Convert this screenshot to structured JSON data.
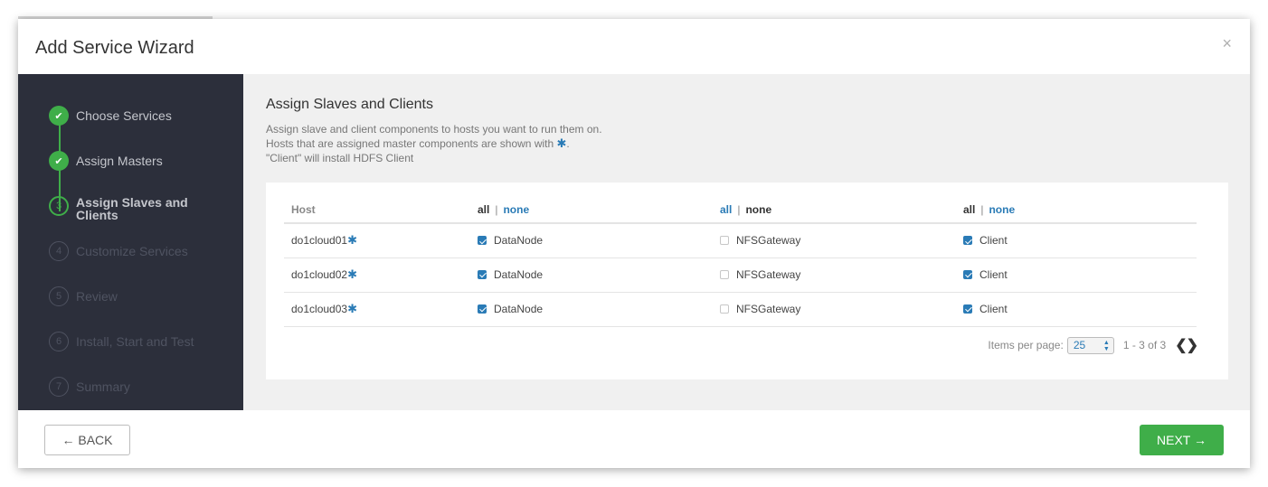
{
  "wizard": {
    "title": "Add Service Wizard",
    "close_glyph": "×",
    "steps": [
      {
        "label": "Choose Services",
        "status": "done",
        "marker": "✔"
      },
      {
        "label": "Assign Masters",
        "status": "done",
        "marker": "✔"
      },
      {
        "label": "Assign Slaves and Clients",
        "status": "active",
        "marker": "3"
      },
      {
        "label": "Customize Services",
        "status": "todo",
        "marker": "4"
      },
      {
        "label": "Review",
        "status": "todo",
        "marker": "5"
      },
      {
        "label": "Install, Start and Test",
        "status": "todo",
        "marker": "6"
      },
      {
        "label": "Summary",
        "status": "todo",
        "marker": "7"
      }
    ]
  },
  "content": {
    "title": "Assign Slaves and Clients",
    "desc_line1": "Assign slave and client components to hosts you want to run them on.",
    "desc_line2": "Hosts that are assigned master components are shown with",
    "desc_line2_end": ".",
    "desc_line3": "\"Client\" will install HDFS Client",
    "master_marker": "✱"
  },
  "table": {
    "host_header": "Host",
    "all_label": "all",
    "none_label": "none",
    "separator": "|",
    "rows": [
      {
        "host": "do1cloud01",
        "datanode": {
          "label": "DataNode",
          "checked": true
        },
        "nfs": {
          "label": "NFSGateway",
          "checked": false
        },
        "client": {
          "label": "Client",
          "checked": true
        }
      },
      {
        "host": "do1cloud02",
        "datanode": {
          "label": "DataNode",
          "checked": true
        },
        "nfs": {
          "label": "NFSGateway",
          "checked": false
        },
        "client": {
          "label": "Client",
          "checked": true
        }
      },
      {
        "host": "do1cloud03",
        "datanode": {
          "label": "DataNode",
          "checked": true
        },
        "nfs": {
          "label": "NFSGateway",
          "checked": false
        },
        "client": {
          "label": "Client",
          "checked": true
        }
      }
    ]
  },
  "pagination": {
    "items_per_page_label": "Items per page:",
    "items_per_page_value": "25",
    "range": "1 - 3 of 3",
    "prev_glyph": "❮",
    "next_glyph": "❯"
  },
  "footer": {
    "back_label": "← BACK",
    "next_label": "NEXT →"
  },
  "colors": {
    "sidebar_bg": "#2c2f3b",
    "accent_green": "#3fae49",
    "link_blue": "#2a7bb6",
    "content_bg": "#f0f0f0"
  }
}
